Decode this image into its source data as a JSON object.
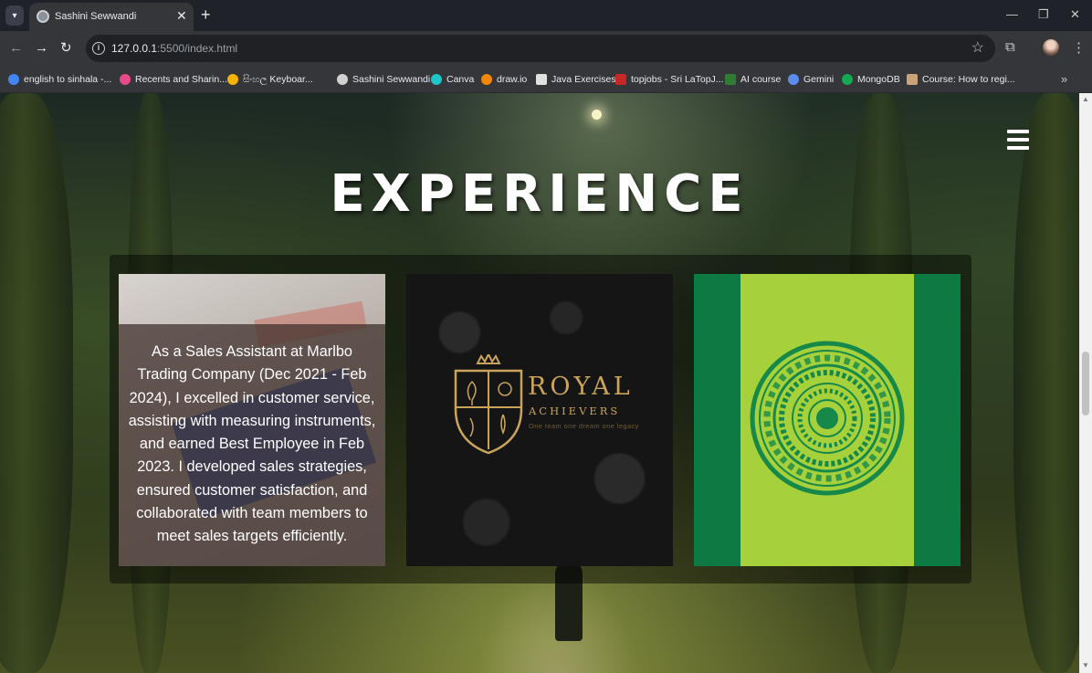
{
  "browser": {
    "tab_title": "Sashini Sewwandi",
    "url_host": "127.0.0.1",
    "url_rest": ":5500/index.html",
    "bookmarks": [
      {
        "label": "english to sinhala -...",
        "color": "#4285f4"
      },
      {
        "label": "Recents and Sharin...",
        "color": "#e94b8a"
      },
      {
        "label": "සිංහල Keyboar...",
        "color": "#f4b400"
      },
      {
        "label": "Sashini Sewwandi",
        "color": "#d0d0d0"
      },
      {
        "label": "Canva",
        "color": "#20c4cb"
      },
      {
        "label": "draw.io",
        "color": "#f08705"
      },
      {
        "label": "Java Exercises",
        "color": "#e0e0e0"
      },
      {
        "label": "topjobs - Sri LaTopJ...",
        "color": "#c62828"
      },
      {
        "label": "AI course",
        "color": "#2e7d32"
      },
      {
        "label": "Gemini",
        "color": "#5b8def"
      },
      {
        "label": "MongoDB",
        "color": "#13aa52"
      },
      {
        "label": "Course: How to regi...",
        "color": "#c9a27a"
      }
    ]
  },
  "page": {
    "heading": "EXPERIENCE",
    "cards": [
      {
        "name": "sales-assistant",
        "description": "As a Sales Assistant at Marlbo Trading Company (Dec 2021 - Feb 2024), I excelled in customer service, assisting with measuring instruments, and earned Best Employee in Feb 2023. I developed sales strategies, ensured customer satisfaction, and collaborated with team members to meet sales targets efficiently."
      },
      {
        "name": "royal-achievers",
        "logo_word": "ROYAL",
        "logo_sub": "ACHIEVERS",
        "logo_tagline": "One team one dream one legacy"
      },
      {
        "name": "green-emblem",
        "colors": {
          "outer": "#0d7a44",
          "inner": "#a6d13a",
          "emblem": "#15884a"
        }
      }
    ]
  }
}
